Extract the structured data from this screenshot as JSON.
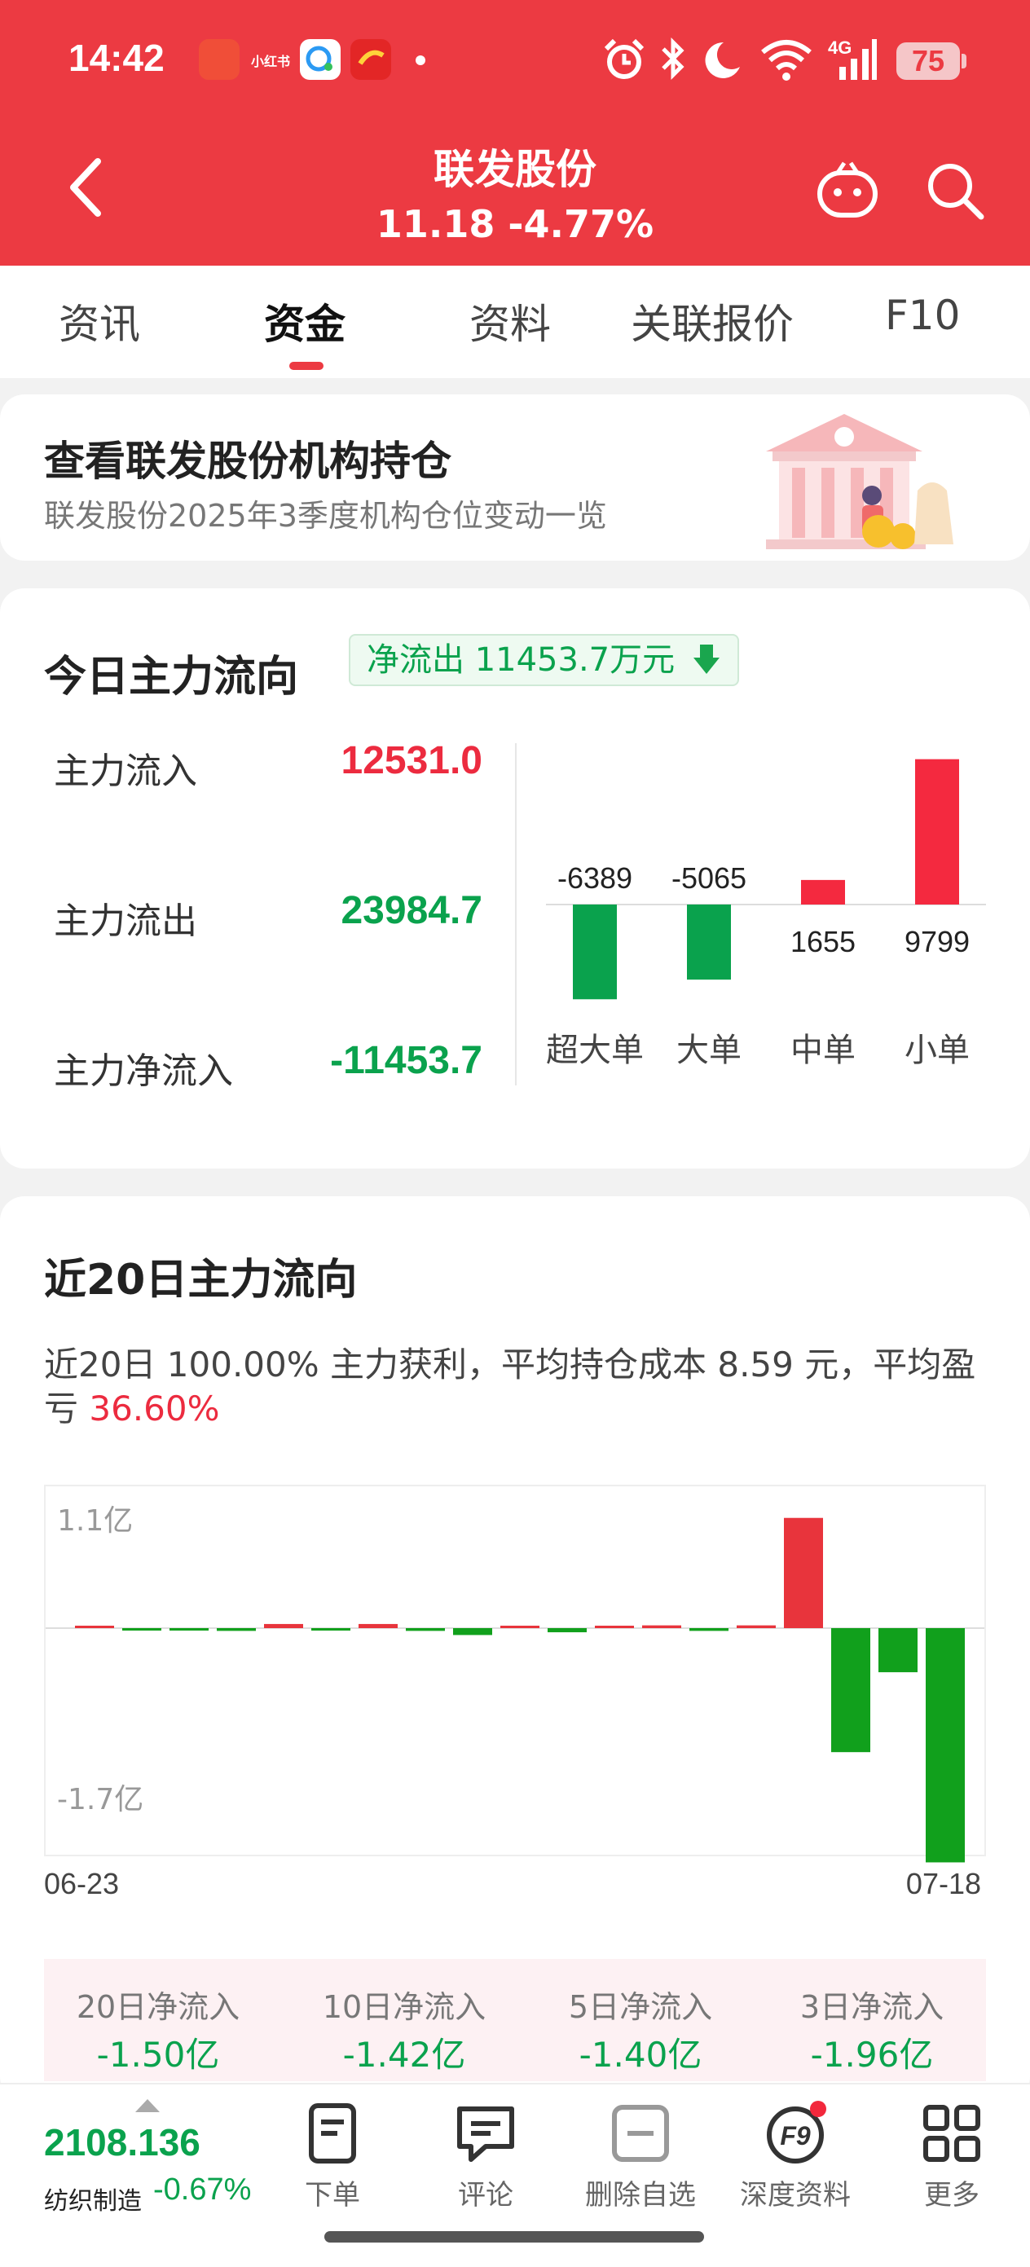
{
  "status_bar": {
    "time": "14:42",
    "app_badges": [
      "小红书"
    ],
    "network": "4G",
    "battery": "75",
    "icons": [
      "alarm-icon",
      "bluetooth-icon",
      "moon-icon",
      "wifi-icon",
      "signal-icon"
    ]
  },
  "header": {
    "title": "联发股份",
    "price_line": "11.18 -4.77%",
    "back_icon": "chevron-left-icon",
    "robot_icon": "robot-icon",
    "search_icon": "search-icon",
    "color": "#ec3a42"
  },
  "tabs": [
    {
      "label": "资讯",
      "active": false
    },
    {
      "label": "资金",
      "active": true
    },
    {
      "label": "资料",
      "active": false
    },
    {
      "label": "关联报价",
      "active": false
    },
    {
      "label": "F10",
      "active": false
    }
  ],
  "promo": {
    "title": "查看联发股份机构持仓",
    "subtitle": "联发股份2025年3季度机构仓位变动一览"
  },
  "today_flow": {
    "title": "今日主力流向",
    "net_badge": "净流出 11453.7万元",
    "rows": [
      {
        "label": "主力流入",
        "value": "12531.0",
        "color": "red"
      },
      {
        "label": "主力流出",
        "value": "23984.7",
        "color": "green"
      },
      {
        "label": "主力净流入",
        "value": "-11453.7",
        "color": "green"
      }
    ]
  },
  "chart_data": [
    {
      "type": "bar",
      "categories": [
        "超大单",
        "大单",
        "中单",
        "小单"
      ],
      "values": [
        -6389,
        -5065,
        1655,
        9799
      ],
      "data_labels": [
        "-6389",
        "-5065",
        "1655",
        "9799"
      ],
      "colors": {
        "positive": "#f4293f",
        "negative": "#0aa24d"
      }
    },
    {
      "type": "bar",
      "title": "近20日主力流向",
      "x_start_label": "06-23",
      "x_end_label": "07-18",
      "y_max_label": "1.1亿",
      "y_min_label": "-1.7亿",
      "ylim": [
        -1.7,
        1.1
      ],
      "unit": "亿",
      "values": [
        0.01,
        -0.01,
        -0.01,
        -0.02,
        0.03,
        -0.01,
        0.03,
        -0.02,
        -0.05,
        0.0,
        -0.03,
        0.0,
        0.02,
        -0.02,
        0.02,
        0.8,
        -0.9,
        -0.32,
        -1.7
      ],
      "colors": {
        "positive": "#e8343c",
        "negative": "#11a01c"
      }
    }
  ],
  "recent_flow": {
    "title": "近20日主力流向",
    "description_prefix": "近20日 100.00% 主力获利，平均持仓成本 8.59 元，平均盈亏 ",
    "description_highlight": "36.60%"
  },
  "summary": [
    {
      "label": "20日净流入",
      "value": "-1.50亿"
    },
    {
      "label": "10日净流入",
      "value": "-1.42亿"
    },
    {
      "label": "5日净流入",
      "value": "-1.40亿"
    },
    {
      "label": "3日净流入",
      "value": "-1.96亿"
    }
  ],
  "bottom_bar": {
    "index_value": "2108.136",
    "index_name": "纺织制造",
    "index_change": "-0.67%",
    "nav": [
      {
        "label": "下单",
        "icon": "order-icon"
      },
      {
        "label": "评论",
        "icon": "comment-icon"
      },
      {
        "label": "删除自选",
        "icon": "remove-watchlist-icon"
      },
      {
        "label": "深度资料",
        "icon": "f9-icon",
        "icon_text": "F9"
      },
      {
        "label": "更多",
        "icon": "grid-more-icon"
      }
    ]
  }
}
